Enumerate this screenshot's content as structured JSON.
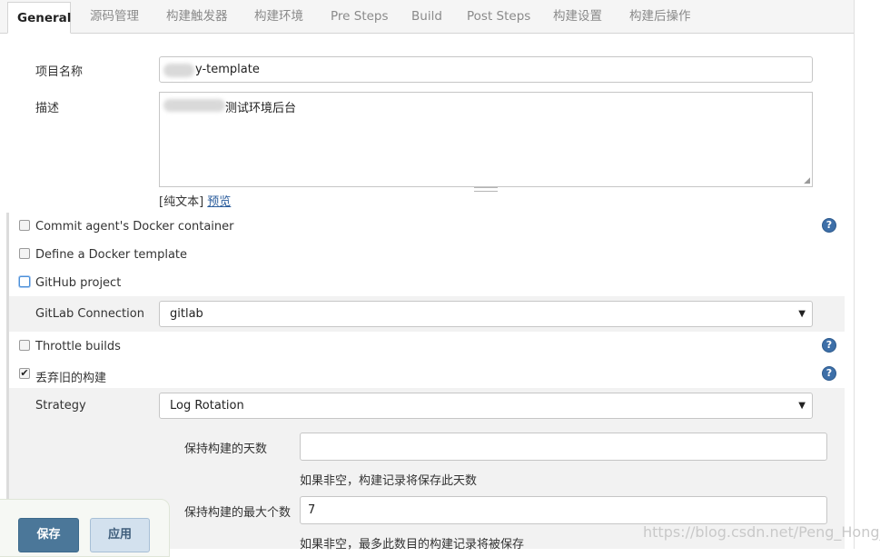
{
  "tabs": [
    {
      "label": "General",
      "active": true
    },
    {
      "label": "源码管理"
    },
    {
      "label": "构建触发器"
    },
    {
      "label": "构建环境"
    },
    {
      "label": "Pre Steps"
    },
    {
      "label": "Build"
    },
    {
      "label": "Post Steps"
    },
    {
      "label": "构建设置"
    },
    {
      "label": "构建后操作"
    }
  ],
  "general": {
    "project_name_label": "项目名称",
    "project_name_value": "y-template",
    "description_label": "描述",
    "description_value": "测试环境后台",
    "plain_text_link": "[纯文本]",
    "preview_link": "预览"
  },
  "options": {
    "commit_docker": {
      "label": "Commit agent's Docker container",
      "checked": false
    },
    "define_docker": {
      "label": "Define a Docker template",
      "checked": false
    },
    "github_project": {
      "label": "GitHub project",
      "checked": false
    },
    "gitlab_connection_label": "GitLab Connection",
    "gitlab_connection_value": "gitlab",
    "throttle_builds": {
      "label": "Throttle builds",
      "checked": false
    },
    "discard_old_builds": {
      "label": "丢弃旧的构建",
      "checked": true,
      "mark": "✔"
    }
  },
  "strategy": {
    "label": "Strategy",
    "value": "Log Rotation",
    "days_label": "保持构建的天数",
    "days_value": "",
    "days_hint": "如果非空，构建记录将保存此天数",
    "max_label": "保持构建的最大个数",
    "max_value": "7",
    "max_hint": "如果非空，最多此数目的构建记录将被保存"
  },
  "buttons": {
    "save": "保存",
    "apply": "应用"
  },
  "icons": {
    "help": "?",
    "dropdown": "▼"
  },
  "watermark": "https://blog.csdn.net/Peng_Hong_fu",
  "colors": {
    "primary_button": "#4b7799",
    "help_icon": "#3d6fa8",
    "link": "#2b5d9c"
  }
}
